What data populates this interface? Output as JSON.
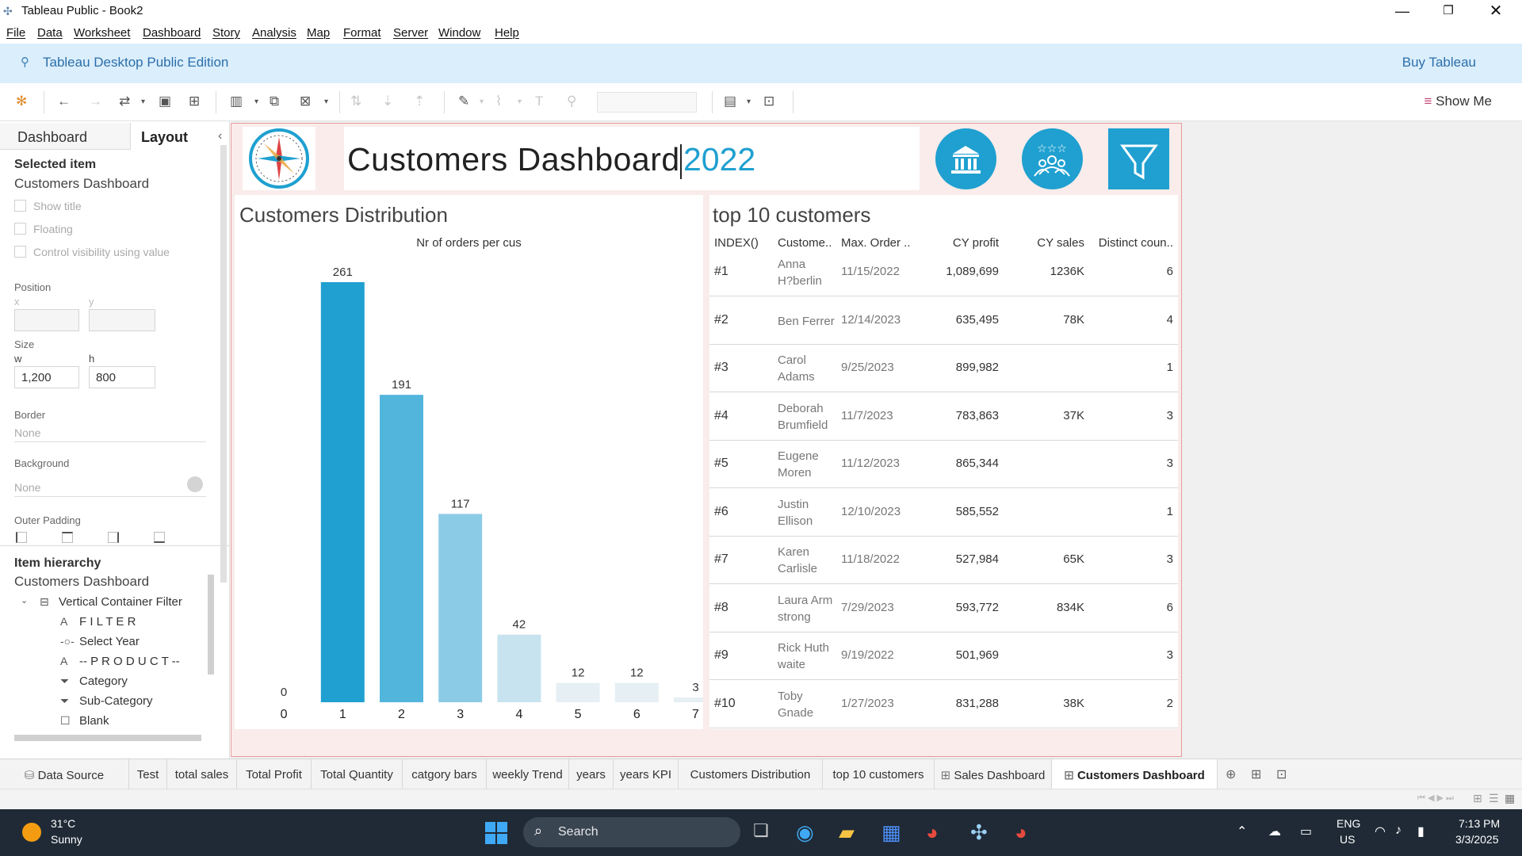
{
  "window": {
    "title": "Tableau Public - Book2"
  },
  "menu": [
    "File",
    "Data",
    "Worksheet",
    "Dashboard",
    "Story",
    "Analysis",
    "Map",
    "Format",
    "Server",
    "Window",
    "Help"
  ],
  "banner": {
    "edition": "Tableau Desktop Public Edition",
    "buy": "Buy Tableau"
  },
  "toolbar": {
    "show_me": "Show Me"
  },
  "leftpane": {
    "tabs": {
      "dashboard": "Dashboard",
      "layout": "Layout"
    },
    "selected_item_label": "Selected item",
    "selected_item": "Customers Dashboard",
    "checkboxes": [
      "Show title",
      "Floating",
      "Control visibility using value"
    ],
    "position_label": "Position",
    "x_label": "x",
    "y_label": "y",
    "size_label": "Size",
    "w_label": "w",
    "h_label": "h",
    "w_value": "1,200",
    "h_value": "800",
    "border_label": "Border",
    "border_value": "None",
    "background_label": "Background",
    "background_value": "None",
    "outer_padding_label": "Outer Padding",
    "hierarchy_label": "Item hierarchy",
    "hierarchy_root": "Customers Dashboard",
    "hierarchy": [
      {
        "icon": "container-icon",
        "glyph": "⊟",
        "label": "Vertical Container Filter"
      },
      {
        "icon": "text-icon",
        "glyph": "A",
        "label": "F I L T E R"
      },
      {
        "icon": "parameter-icon",
        "glyph": "-○-",
        "label": "Select Year"
      },
      {
        "icon": "text-icon",
        "glyph": "A",
        "label": "-- P R O D U C T --"
      },
      {
        "icon": "filter-icon",
        "glyph": "⏷",
        "label": "Category"
      },
      {
        "icon": "filter-icon",
        "glyph": "⏷",
        "label": "Sub-Category"
      },
      {
        "icon": "blank-icon",
        "glyph": "☐",
        "label": "Blank"
      }
    ]
  },
  "dashboard": {
    "title": "Customers Dashboard",
    "year": "2022",
    "dist_title": "Customers Distribution",
    "dist_subtitle": "Nr of orders per cus",
    "top10_title": "top 10 customers",
    "top10_headers": [
      "INDEX()",
      "Custome..",
      "Max. Order ..",
      "CY profit",
      "CY sales",
      "Distinct coun.."
    ],
    "top10_rows": [
      {
        "index": "#1",
        "name": [
          "Anna",
          "H?berlin"
        ],
        "date": "11/15/2022",
        "profit": "1,089,699",
        "sales": "1236K",
        "distinct": "6"
      },
      {
        "index": "#2",
        "name": [
          "Ben Ferrer"
        ],
        "date": "12/14/2023",
        "profit": "635,495",
        "sales": "78K",
        "distinct": "4"
      },
      {
        "index": "#3",
        "name": [
          "Carol",
          "Adams"
        ],
        "date": "9/25/2023",
        "profit": "899,982",
        "sales": "",
        "distinct": "1"
      },
      {
        "index": "#4",
        "name": [
          "Deborah",
          "Brumfield"
        ],
        "date": "11/7/2023",
        "profit": "783,863",
        "sales": "37K",
        "distinct": "3"
      },
      {
        "index": "#5",
        "name": [
          "Eugene",
          "Moren"
        ],
        "date": "11/12/2023",
        "profit": "865,344",
        "sales": "",
        "distinct": "3"
      },
      {
        "index": "#6",
        "name": [
          "Justin",
          "Ellison"
        ],
        "date": "12/10/2023",
        "profit": "585,552",
        "sales": "",
        "distinct": "1"
      },
      {
        "index": "#7",
        "name": [
          "Karen",
          "Carlisle"
        ],
        "date": "11/18/2022",
        "profit": "527,984",
        "sales": "65K",
        "distinct": "3"
      },
      {
        "index": "#8",
        "name": [
          "Laura Arm",
          "strong"
        ],
        "date": "7/29/2023",
        "profit": "593,772",
        "sales": "834K",
        "distinct": "6"
      },
      {
        "index": "#9",
        "name": [
          "Rick Huth",
          "waite"
        ],
        "date": "9/19/2022",
        "profit": "501,969",
        "sales": "",
        "distinct": "3"
      },
      {
        "index": "#10",
        "name": [
          "Toby",
          "Gnade"
        ],
        "date": "1/27/2023",
        "profit": "831,288",
        "sales": "38K",
        "distinct": "2"
      }
    ]
  },
  "chart_data": {
    "type": "bar",
    "title": "Nr of orders per cus",
    "categories": [
      "0",
      "1",
      "2",
      "3",
      "4",
      "5",
      "6",
      "7"
    ],
    "values": [
      0,
      261,
      191,
      117,
      42,
      12,
      12,
      3
    ],
    "colors": [
      "#1fa0d0",
      "#1fa0d0",
      "#52b5dc",
      "#8ccbe6",
      "#c7e3ef",
      "#e6eff4",
      "#e6eff4",
      "#e6eff4"
    ],
    "ylim": [
      0,
      261
    ],
    "grid": false
  },
  "sheet_tabs": [
    {
      "label": "Data Source",
      "icon": "database-icon"
    },
    {
      "label": "Test"
    },
    {
      "label": "total sales"
    },
    {
      "label": "Total Profit"
    },
    {
      "label": "Total Quantity"
    },
    {
      "label": "catgory bars"
    },
    {
      "label": "weekly Trend"
    },
    {
      "label": "years"
    },
    {
      "label": "years KPI"
    },
    {
      "label": "Customers Distribution"
    },
    {
      "label": "top 10 customers"
    },
    {
      "label": "Sales Dashboard",
      "icon": "dashboard-icon"
    },
    {
      "label": "Customers Dashboard",
      "icon": "dashboard-icon",
      "active": true
    }
  ],
  "taskbar": {
    "weather_temp": "31°C",
    "weather_text": "Sunny",
    "search": "Search",
    "lang": "ENG",
    "region": "US",
    "time": "7:13 PM",
    "date": "3/3/2025"
  },
  "colors": {
    "accent": "#1fa0d0",
    "banner": "#dbeefc",
    "frame_border": "#e79b9b"
  }
}
